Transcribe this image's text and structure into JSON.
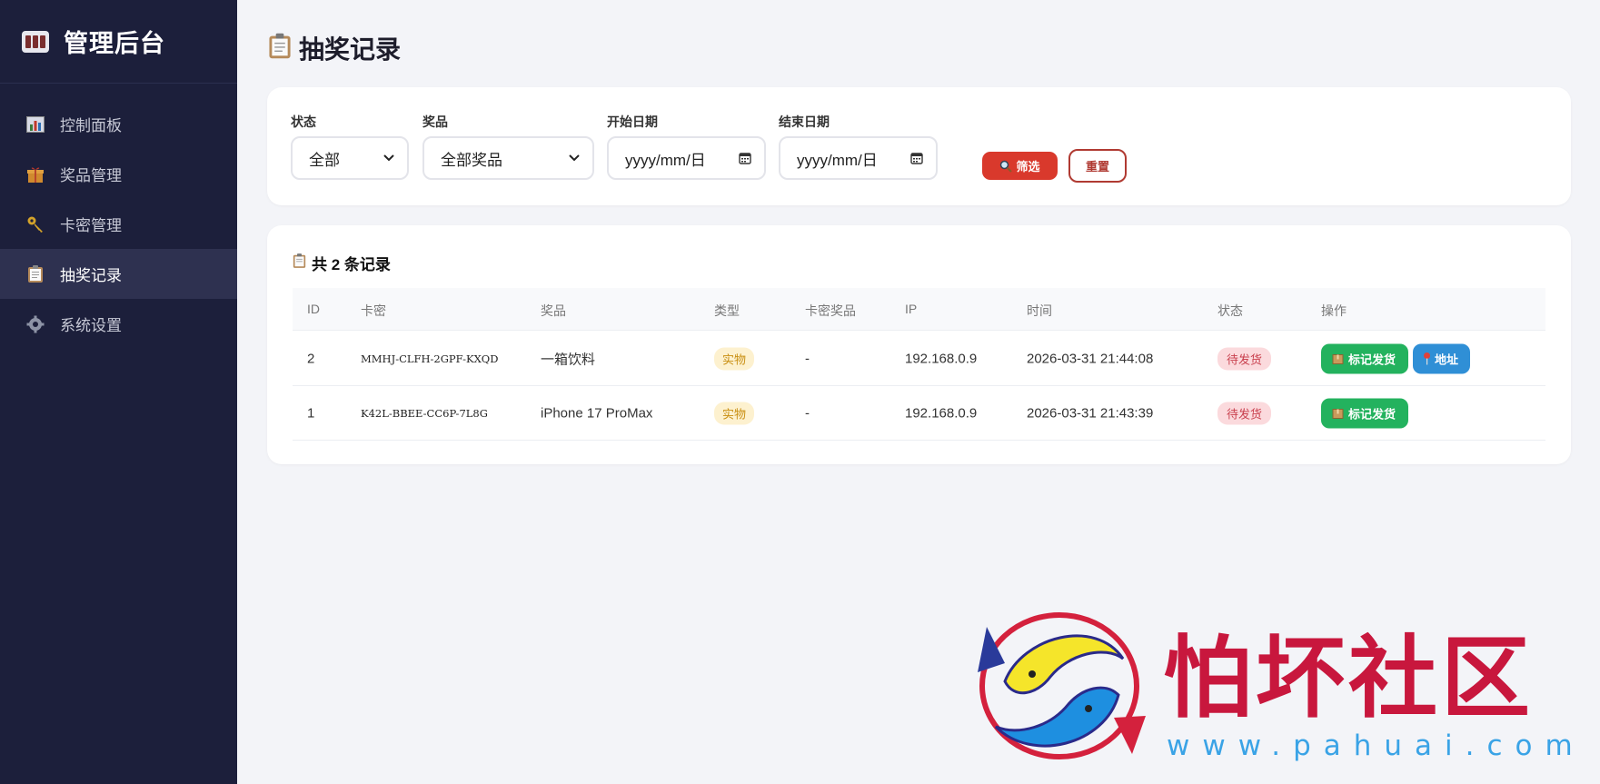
{
  "sidebar": {
    "title": "管理后台",
    "items": [
      {
        "label": "控制面板",
        "icon": "bar-chart-icon"
      },
      {
        "label": "奖品管理",
        "icon": "gift-icon"
      },
      {
        "label": "卡密管理",
        "icon": "key-icon"
      },
      {
        "label": "抽奖记录",
        "icon": "clipboard-icon",
        "active": true
      },
      {
        "label": "系统设置",
        "icon": "gear-icon"
      }
    ]
  },
  "page": {
    "title": "抽奖记录"
  },
  "filters": {
    "status": {
      "label": "状态",
      "value": "全部"
    },
    "prize": {
      "label": "奖品",
      "value": "全部奖品"
    },
    "start_date": {
      "label": "开始日期",
      "placeholder": "yyyy/mm/日"
    },
    "end_date": {
      "label": "结束日期",
      "placeholder": "yyyy/mm/日"
    },
    "filter_button": "筛选",
    "reset_button": "重置"
  },
  "records": {
    "count_text": "共 2 条记录",
    "columns": [
      "ID",
      "卡密",
      "奖品",
      "类型",
      "卡密奖品",
      "IP",
      "时间",
      "状态",
      "操作"
    ],
    "rows": [
      {
        "id": "2",
        "card": "MMHJ-CLFH-2GPF-KXQD",
        "prize": "一箱饮料",
        "type": "实物",
        "card_prize": "-",
        "ip": "192.168.0.9",
        "time": "2026-03-31 21:44:08",
        "status": "待发货",
        "ship_button": "标记发货",
        "address_button": "地址"
      },
      {
        "id": "1",
        "card": "K42L-BBEE-CC6P-7L8G",
        "prize": "iPhone 17 ProMax",
        "type": "实物",
        "card_prize": "-",
        "ip": "192.168.0.9",
        "time": "2026-03-31 21:43:39",
        "status": "待发货",
        "ship_button": "标记发货"
      }
    ]
  },
  "watermark": {
    "text": "怕坏社区",
    "url": "www.pahuai.com"
  },
  "colors": {
    "sidebar_bg": "#1c1f3b",
    "danger": "#d9392c",
    "success": "#23b25e",
    "info": "#2f8fd6",
    "watermark_red": "#c8173d"
  }
}
